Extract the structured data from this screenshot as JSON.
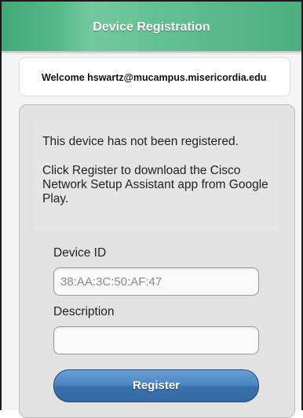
{
  "header": {
    "title": "Device Registration"
  },
  "welcome": {
    "text": "Welcome hswartz@mucampus.misericordia.edu"
  },
  "info": {
    "status": "This device has not been registered.",
    "instructions": "Click Register to download the Cisco Network Setup Assistant app from Google Play."
  },
  "form": {
    "device_id_label": "Device ID",
    "device_id_value": "38:AA:3C:50:AF:47",
    "description_label": "Description",
    "description_value": "",
    "register_label": "Register"
  },
  "colors": {
    "header": "#55b987",
    "button": "#4c86c3"
  }
}
